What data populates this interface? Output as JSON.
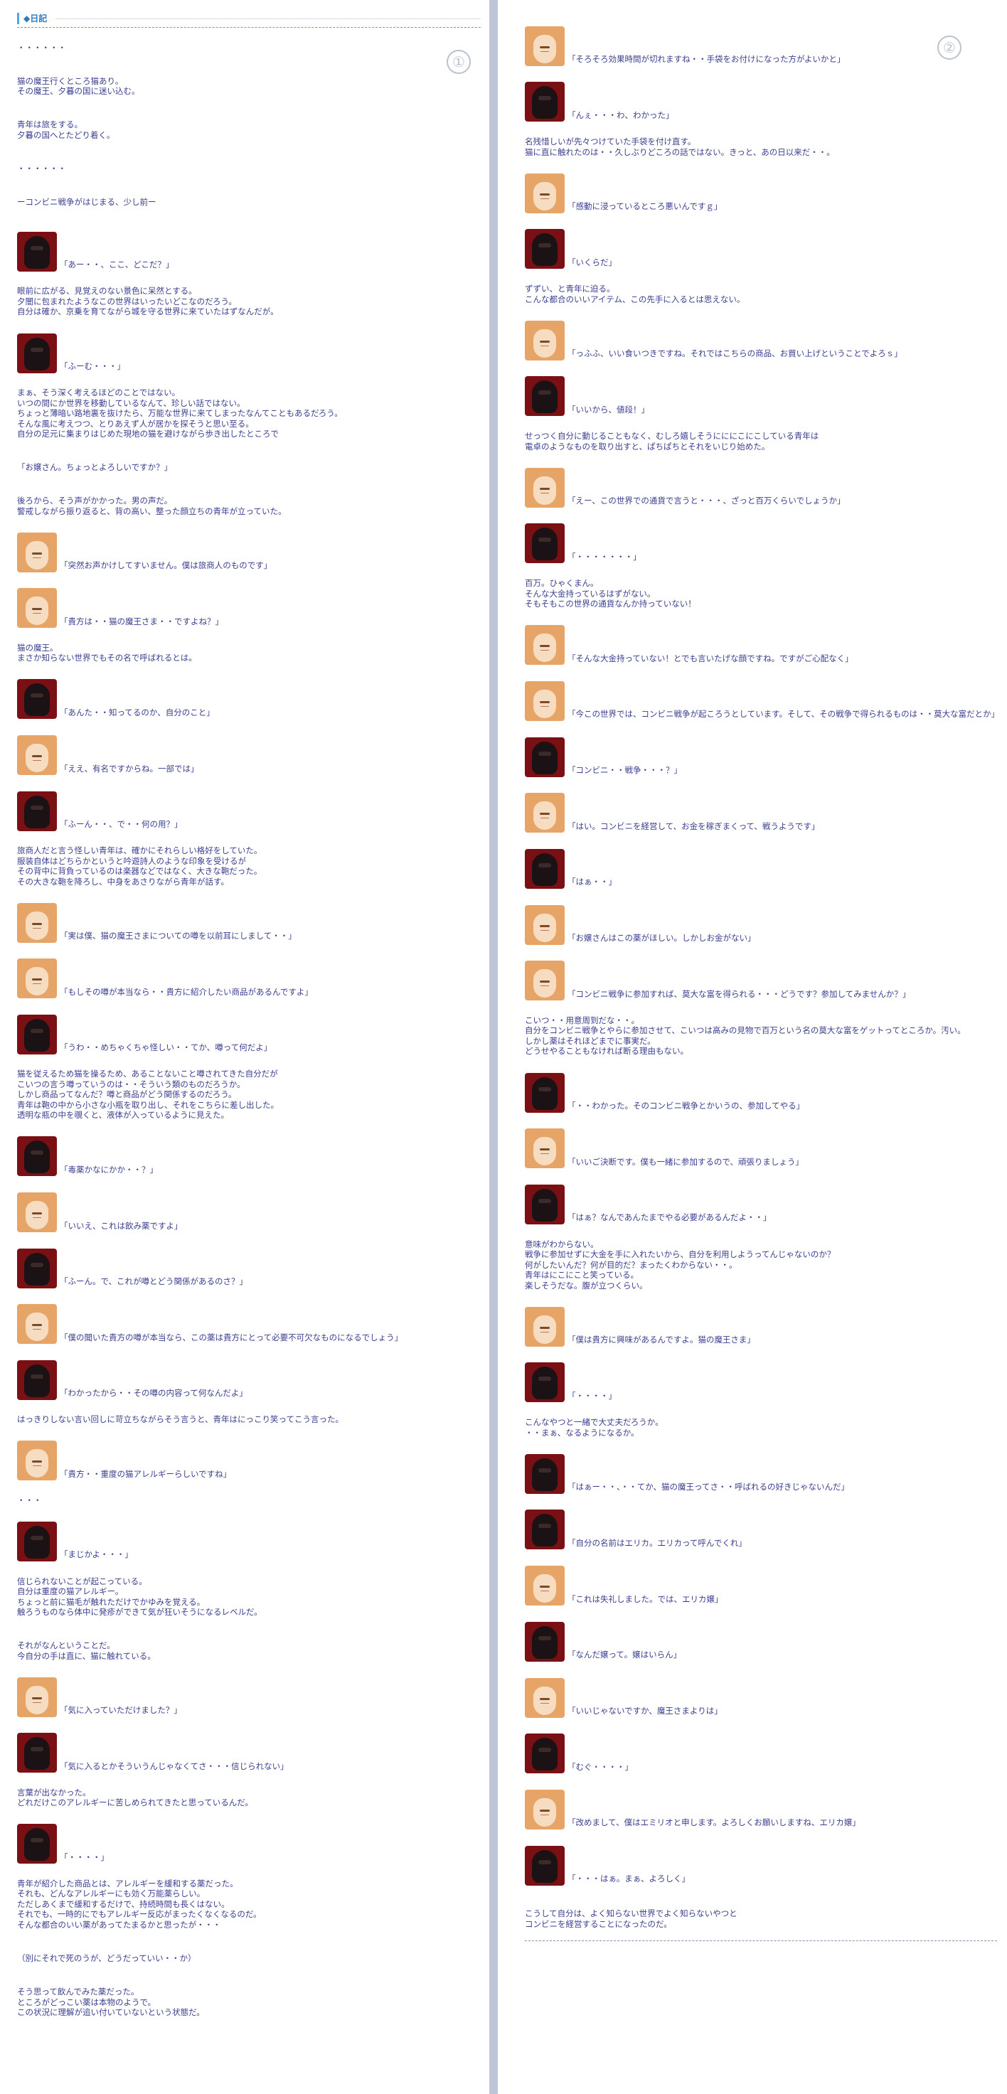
{
  "header": {
    "icon": "diamond-icon",
    "title": "◆日記"
  },
  "page_numbers": [
    "①",
    "②"
  ],
  "left": [
    {
      "type": "text",
      "text": "・・・・・・"
    },
    {
      "type": "gap"
    },
    {
      "type": "text",
      "text": "猫の魔王行くところ猫あり。\nその魔王、夕暮の国に迷い込む。"
    },
    {
      "type": "gap"
    },
    {
      "type": "text",
      "text": "青年は旅をする。\n夕暮の国へとたどり着く。"
    },
    {
      "type": "gap"
    },
    {
      "type": "text",
      "text": "・・・・・・"
    },
    {
      "type": "gap"
    },
    {
      "type": "text",
      "text": "ーコンビニ戦争がはじまる、少し前ー"
    },
    {
      "type": "gap"
    },
    {
      "type": "line",
      "speaker": "demon",
      "text": "「あー・・、ここ、どこだ？」"
    },
    {
      "type": "text",
      "text": "眼前に広がる、見覚えのない景色に呆然とする。\n夕闇に包まれたようなこの世界はいったいどこなのだろう。\n自分は確か、京乗を育てながら城を守る世界に来ていたはずなんだが。"
    },
    {
      "type": "line",
      "speaker": "demon",
      "text": "「ふーむ・・・」"
    },
    {
      "type": "text",
      "text": "まぁ、そう深く考えるほどのことではない。\nいつの間にか世界を移動しているなんて、珍しい話ではない。\nちょっと薄暗い路地裏を抜けたら、万能な世界に来てしまったなんてこともあるだろう。\nそんな風に考えつつ、とりあえず人が居かを探そうと思い至る。\n自分の足元に集まりはじめた現地の猫を避けながら歩き出したところで"
    },
    {
      "type": "gap"
    },
    {
      "type": "text",
      "text": "「お嬢さん。ちょっとよろしいですか？」"
    },
    {
      "type": "gap"
    },
    {
      "type": "text",
      "text": "後ろから、そう声がかかった。男の声だ。\n警戒しながら振り返ると、背の高い、整った顔立ちの青年が立っていた。"
    },
    {
      "type": "line",
      "speaker": "merchant",
      "text": "「突然お声かけしてすいません。僕は旅商人のものです」"
    },
    {
      "type": "line",
      "speaker": "merchant",
      "text": "「貴方は・・猫の魔王さま・・ですよね？」"
    },
    {
      "type": "text",
      "text": "猫の魔王。\nまさか知らない世界でもその名で呼ばれるとは。"
    },
    {
      "type": "line",
      "speaker": "demon",
      "text": "「あんた・・知ってるのか、自分のこと」"
    },
    {
      "type": "line",
      "speaker": "merchant",
      "text": "「ええ、有名ですからね。一部では」"
    },
    {
      "type": "line",
      "speaker": "demon",
      "text": "「ふーん・・、で・・何の用？」"
    },
    {
      "type": "text",
      "text": "旅商人だと言う怪しい青年は、確かにそれらしい格好をしていた。\n服装自体はどちらかというと吟遊詩人のような印象を受けるが\nその背中に背負っているのは楽器などではなく、大きな鞄だった。\nその大きな鞄を降ろし、中身をあさりながら青年が話す。"
    },
    {
      "type": "line",
      "speaker": "merchant",
      "text": "「実は僕、猫の魔王さまについての噂を以前耳にしまして・・」"
    },
    {
      "type": "line",
      "speaker": "merchant",
      "text": "「もしその噂が本当なら・・貴方に紹介したい商品があるんですよ」"
    },
    {
      "type": "line",
      "speaker": "demon",
      "text": "「うわ・・めちゃくちゃ怪しい・・てか、噂って何だよ」"
    },
    {
      "type": "text",
      "text": "猫を従えるため猫を操るため、あることないこと噂されてきた自分だが\nこいつの言う噂っていうのは・・そういう類のものだろうか。\nしかし商品ってなんだ？噂と商品がどう関係するのだろう。\n青年は鞄の中から小さな小瓶を取り出し、それをこちらに差し出した。\n透明な瓶の中を覗くと、液体が入っているように見えた。"
    },
    {
      "type": "line",
      "speaker": "demon",
      "text": "「毒薬かなにかか・・？」"
    },
    {
      "type": "line",
      "speaker": "merchant",
      "text": "「いいえ、これは飲み薬ですよ」"
    },
    {
      "type": "line",
      "speaker": "demon",
      "text": "「ふーん。で、これが噂とどう関係があるのさ？」"
    },
    {
      "type": "line",
      "speaker": "merchant",
      "text": "「僕の聞いた貴方の噂が本当なら、この薬は貴方にとって必要不可欠なものになるでしょう」"
    },
    {
      "type": "line",
      "speaker": "demon",
      "text": "「わかったから・・その噂の内容って何なんだよ」"
    },
    {
      "type": "text",
      "text": "はっきりしない言い回しに苛立ちながらそう言うと、青年はにっこり笑ってこう言った。"
    },
    {
      "type": "line",
      "speaker": "merchant",
      "text": "「貴方・・重度の猫アレルギーらしいですね」"
    },
    {
      "type": "text",
      "text": "・・・"
    },
    {
      "type": "line",
      "speaker": "demon",
      "text": "「まじかよ・・・」"
    },
    {
      "type": "text",
      "text": "信じられないことが起こっている。\n自分は重度の猫アレルギー。\nちょっと前に猫毛が触れただけでかゆみを覚える。\n触ろうものなら体中に発疹ができて気が狂いそうになるレベルだ。"
    },
    {
      "type": "gap"
    },
    {
      "type": "text",
      "text": "それがなんということだ。\n今自分の手は直に、猫に触れている。"
    },
    {
      "type": "line",
      "speaker": "merchant",
      "text": "「気に入っていただけました？」"
    },
    {
      "type": "line",
      "speaker": "demon",
      "text": "「気に入るとかそういうんじゃなくてさ・・・信じられない」"
    },
    {
      "type": "text",
      "text": "言葉が出なかった。\nどれだけこのアレルギーに苦しめられてきたと思っているんだ。"
    },
    {
      "type": "line",
      "speaker": "demon",
      "text": "「・・・・」"
    },
    {
      "type": "text",
      "text": "青年が紹介した商品とは、アレルギーを緩和する薬だった。\nそれも、どんなアレルギーにも効く万能薬らしい。\nただしあくまで緩和するだけで、持続時間も長くはない。\nそれでも、一時的にでもアレルギー反応がまったくなくなるのだ。\nそんな都合のいい薬があってたまるかと思ったが・・・"
    },
    {
      "type": "gap"
    },
    {
      "type": "text",
      "text": "（別にそれで死のうが、どうだっていい・・か）"
    },
    {
      "type": "gap"
    },
    {
      "type": "text",
      "text": "そう思って飲んでみた薬だった。\nところがどっこい薬は本物のようで。\nこの状況に理解が追い付いていないという状態だ。"
    }
  ],
  "right": [
    {
      "type": "line",
      "speaker": "merchant",
      "text": "「そろそろ効果時間が切れますね・・手袋をお付けになった方がよいかと」"
    },
    {
      "type": "line",
      "speaker": "demon",
      "text": "「んぇ・・・わ、わかった」"
    },
    {
      "type": "text",
      "text": "名残惜しいが先々つけていた手袋を付け直す。\n猫に直に触れたのは・・久しぶりどころの話ではない。きっと、あの日以来だ・・。"
    },
    {
      "type": "line",
      "speaker": "merchant",
      "text": "「感動に浸っているところ悪いんですｇ」"
    },
    {
      "type": "line",
      "speaker": "demon",
      "text": "「いくらだ」"
    },
    {
      "type": "text",
      "text": "ずずい、と青年に迫る。\nこんな都合のいいアイテム、この先手に入るとは思えない。"
    },
    {
      "type": "line",
      "speaker": "merchant",
      "text": "「っふふ、いい食いつきですね。それではこちらの商品、お買い上げということでよろｓ」"
    },
    {
      "type": "line",
      "speaker": "demon",
      "text": "「いいから、値段！」"
    },
    {
      "type": "text",
      "text": "せっつく自分に動じることもなく、むしろ嬉しそうにににこにこしている青年は\n電卓のようなものを取り出すと、ぱちぱちとそれをいじり始めた。"
    },
    {
      "type": "line",
      "speaker": "merchant",
      "text": "「えー、この世界での通貨で言うと・・・、ざっと百万くらいでしょうか」"
    },
    {
      "type": "line",
      "speaker": "demon",
      "text": "「・・・・・・・」"
    },
    {
      "type": "text",
      "text": "百万。ひゃくまん。\nそんな大金持っているはずがない。\nそもそもこの世界の通貨なんか持っていない！"
    },
    {
      "type": "line",
      "speaker": "merchant",
      "text": "「そんな大金持っていない！とでも言いたげな顔ですね。ですがご心配なく」"
    },
    {
      "type": "line",
      "speaker": "merchant",
      "text": "「今この世界では、コンビニ戦争が起ころうとしています。そして、その戦争で得られるものは・・莫大な富だとか」"
    },
    {
      "type": "line",
      "speaker": "demon",
      "text": "「コンビニ・・戦争・・・？」"
    },
    {
      "type": "line",
      "speaker": "merchant",
      "text": "「はい。コンビニを経営して、お金を稼ぎまくって、戦うようです」"
    },
    {
      "type": "line",
      "speaker": "demon",
      "text": "「はぁ・・」"
    },
    {
      "type": "line",
      "speaker": "merchant",
      "text": "「お嬢さんはこの薬がほしい。しかしお金がない」"
    },
    {
      "type": "line",
      "speaker": "merchant",
      "text": "「コンビニ戦争に参加すれば、莫大な富を得られる・・・どうです？参加してみませんか？」"
    },
    {
      "type": "text",
      "text": "こいつ・・用意周到だな・・。\n自分をコンビニ戦争とやらに参加させて、こいつは高みの見物で百万という名の莫大な富をゲットってところか。汚い。\nしかし薬はそれほどまでに事実だ。\nどうせやることもなければ断る理由もない。"
    },
    {
      "type": "line",
      "speaker": "demon",
      "text": "「・・わかった。そのコンビニ戦争とかいうの、参加してやる」"
    },
    {
      "type": "line",
      "speaker": "merchant",
      "text": "「いいご決断です。僕も一緒に参加するので、頑張りましょう」"
    },
    {
      "type": "line",
      "speaker": "demon",
      "text": "「はぁ？なんであんたまでやる必要があるんだよ・・」"
    },
    {
      "type": "text",
      "text": "意味がわからない。\n戦争に参加せずに大金を手に入れたいから、自分を利用しようってんじゃないのか？\n何がしたいんだ？何が目的だ？まったくわからない・・。\n青年はにこにこと笑っている。\n楽しそうだな。腹が立つくらい。"
    },
    {
      "type": "line",
      "speaker": "merchant",
      "text": "「僕は貴方に興味があるんですよ。猫の魔王さま」"
    },
    {
      "type": "line",
      "speaker": "demon",
      "text": "「・・・・」"
    },
    {
      "type": "text",
      "text": "こんなやつと一緒で大丈夫だろうか。\n・・まぁ、なるようになるか。"
    },
    {
      "type": "line",
      "speaker": "demon",
      "text": "「はぁー・・、・・てか、猫の魔王ってさ・・呼ばれるの好きじゃないんだ」"
    },
    {
      "type": "line",
      "speaker": "demon",
      "text": "「自分の名前はエリカ。エリカって呼んでくれ」"
    },
    {
      "type": "line",
      "speaker": "merchant",
      "text": "「これは失礼しました。では、エリカ嬢」"
    },
    {
      "type": "line",
      "speaker": "demon",
      "text": "「なんだ嬢って。嬢はいらん」"
    },
    {
      "type": "line",
      "speaker": "merchant",
      "text": "「いいじゃないですか、魔王さまよりは」"
    },
    {
      "type": "line",
      "speaker": "demon",
      "text": "「むぐ・・・・」"
    },
    {
      "type": "line",
      "speaker": "merchant",
      "text": "「改めまして、僕はエミリオと申します。よろしくお願いしますね、エリカ嬢」"
    },
    {
      "type": "line",
      "speaker": "demon",
      "text": "「・・・はぁ。まぁ、よろしく」"
    },
    {
      "type": "gap"
    },
    {
      "type": "text",
      "text": "こうして自分は、よく知らない世界でよく知らないやつと\nコンビニを経営することになったのだ。"
    }
  ]
}
